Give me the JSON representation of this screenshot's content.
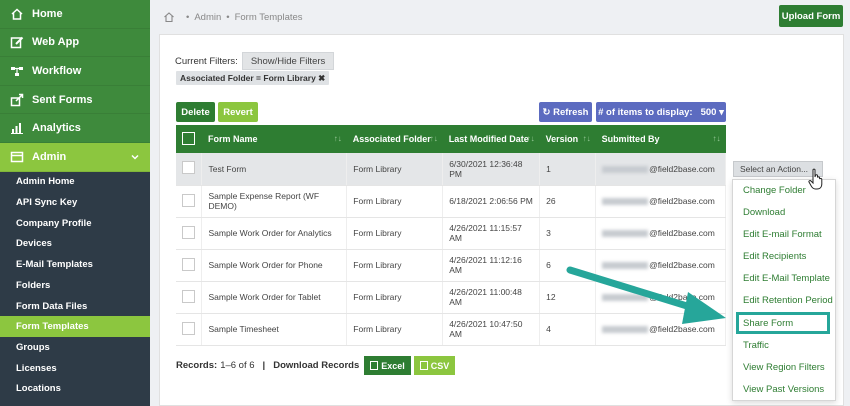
{
  "sidebar": {
    "main": [
      {
        "label": "Home",
        "icon": "home-icon"
      },
      {
        "label": "Web App",
        "icon": "edit-icon"
      },
      {
        "label": "Workflow",
        "icon": "workflow-icon"
      },
      {
        "label": "Sent Forms",
        "icon": "send-icon"
      },
      {
        "label": "Analytics",
        "icon": "chart-icon"
      },
      {
        "label": "Admin",
        "icon": "admin-icon"
      }
    ],
    "sub": [
      "Admin Home",
      "API Sync Key",
      "Company Profile",
      "Devices",
      "E-Mail Templates",
      "Folders",
      "Form Data Files",
      "Form Templates",
      "Groups",
      "Licenses",
      "Locations"
    ]
  },
  "header": {
    "breadcrumb": [
      "Admin",
      "Form Templates"
    ],
    "upload_label": "Upload Form"
  },
  "filters": {
    "label": "Current Filters:",
    "toggle_label": "Show/Hide Filters",
    "chip": "Associated Folder = Form Library ✖"
  },
  "toolbar": {
    "delete_label": "Delete",
    "revert_label": "Revert",
    "refresh_label": "↻ Refresh",
    "items_label": "# of items to display:",
    "items_value": "500 ▾"
  },
  "table": {
    "headers": [
      "Form Name",
      "Associated Folder",
      "Last Modified Date",
      "Version",
      "Submitted By"
    ],
    "sort_glyph": "↑↓",
    "rows": [
      {
        "name": "Test Form",
        "folder": "Form Library",
        "date": "6/30/2021 12:36:48 PM",
        "version": "1",
        "by": "@field2base.com"
      },
      {
        "name": "Sample Expense Report (WF DEMO)",
        "folder": "Form Library",
        "date": "6/18/2021 2:06:56 PM",
        "version": "26",
        "by": "@field2base.com"
      },
      {
        "name": "Sample Work Order for Analytics",
        "folder": "Form Library",
        "date": "4/26/2021 11:15:57 AM",
        "version": "3",
        "by": "@field2base.com"
      },
      {
        "name": "Sample Work Order for Phone",
        "folder": "Form Library",
        "date": "4/26/2021 11:12:16 AM",
        "version": "6",
        "by": "@field2base.com"
      },
      {
        "name": "Sample Work Order for Tablet",
        "folder": "Form Library",
        "date": "4/26/2021 11:00:48 AM",
        "version": "12",
        "by": "@field2base.com"
      },
      {
        "name": "Sample Timesheet",
        "folder": "Form Library",
        "date": "4/26/2021 10:47:50 AM",
        "version": "4",
        "by": "@field2base.com"
      }
    ]
  },
  "footer": {
    "records_label": "Records:",
    "records_value": "1–6 of 6",
    "download_label": "Download Records",
    "excel_label": "Excel",
    "csv_label": "CSV"
  },
  "actions": {
    "select_label": "Select an Action...",
    "items": [
      "Change Folder",
      "Download",
      "Edit E-mail Format",
      "Edit Recipients",
      "Edit E-Mail Template",
      "Edit Retention Period",
      "Share Form",
      "Traffic",
      "View Region Filters",
      "View Past Versions"
    ]
  },
  "colors": {
    "brand_dark": "#2e7d32",
    "brand_light": "#8cc63f",
    "sidebar": "#2e3b47",
    "accent_blue": "#5c6bc0",
    "annotation": "#26a69a"
  }
}
